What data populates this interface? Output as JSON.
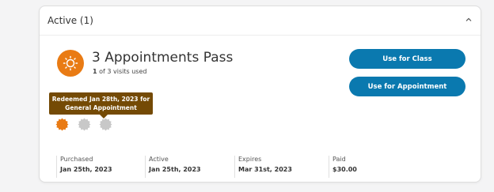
{
  "section": {
    "title": "Active (1)"
  },
  "pass": {
    "name": "3 Appointments Pass",
    "visits_used_count": "1",
    "visits_used_suffix": " of 3 visits used",
    "icon": "sun-icon",
    "accent_color": "#e97b14"
  },
  "actions": {
    "use_for_class": "Use for Class",
    "use_for_appointment": "Use for Appointment",
    "button_color": "#0a79af"
  },
  "tooltip": {
    "line1": "Redeemed Jan 28th, 2023 for",
    "line2": "General Appointment",
    "color": "#744a05"
  },
  "visit_badges": [
    {
      "state": "redeemed",
      "color": "#e97b14"
    },
    {
      "state": "unused",
      "color": "#c8c8c8"
    },
    {
      "state": "unused",
      "color": "#c8c8c8"
    }
  ],
  "details": [
    {
      "label": "Purchased",
      "value": "Jan 25th, 2023"
    },
    {
      "label": "Active",
      "value": "Jan 25th, 2023"
    },
    {
      "label": "Expires",
      "value": "Mar 31st, 2023"
    },
    {
      "label": "Paid",
      "value": "$30.00"
    }
  ]
}
